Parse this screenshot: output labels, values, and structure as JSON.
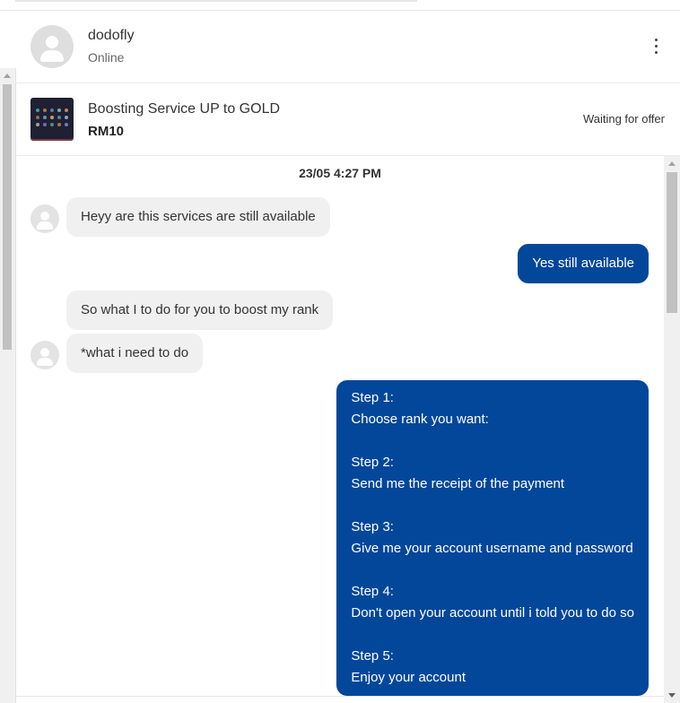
{
  "header": {
    "user_name": "dodofly",
    "user_status": "Online",
    "more_menu_icon": "more-vertical-icon"
  },
  "product": {
    "title": "Boosting Service UP to GOLD",
    "price": "RM10",
    "status": "Waiting for offer"
  },
  "conversation": {
    "date": "23/05  4:27 PM",
    "messages": [
      {
        "from": "buyer",
        "text": "Heyy are this services are still available"
      },
      {
        "from": "seller",
        "text": "Yes still available"
      },
      {
        "from": "buyer",
        "text": "So what I to do for you to boost my rank"
      },
      {
        "from": "buyer",
        "text": "*what i need to do"
      },
      {
        "from": "seller",
        "lines": [
          "Step 1:",
          "Choose rank you want:",
          "",
          "Step 2:",
          "Send me the receipt of the payment",
          "",
          "Step 3:",
          "Give me your account username and password",
          "",
          "Step 4:",
          "Don't open your account until i told you to do so",
          "",
          "Step 5:",
          "Enjoy your account"
        ]
      }
    ]
  },
  "colors": {
    "outgoing_bubble": "#03479b",
    "incoming_bubble": "#f0f0f0"
  }
}
